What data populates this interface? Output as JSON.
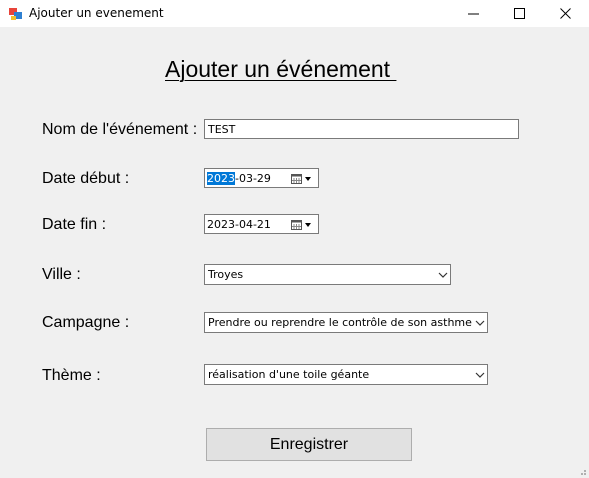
{
  "window": {
    "title": "Ajouter un evenement",
    "controls": {
      "minimize": "minimize-icon",
      "maximize": "maximize-icon",
      "close": "close-icon"
    }
  },
  "form": {
    "heading": "Ajouter un événement ",
    "fields": {
      "name": {
        "label": "Nom de l'événement :",
        "value": "TEST"
      },
      "start_date": {
        "label": "Date début :",
        "value_selected": "2023",
        "value_rest": "-03-29"
      },
      "end_date": {
        "label": "Date fin :",
        "value": "2023-04-21"
      },
      "city": {
        "label": "Ville :",
        "value": "Troyes"
      },
      "campaign": {
        "label": "Campagne :",
        "value": "Prendre ou reprendre le contrôle de son asthme"
      },
      "theme": {
        "label": "Thème :",
        "value": "réalisation d'une toile géante"
      }
    },
    "submit_label": "Enregistrer"
  },
  "colors": {
    "selection": "#0078d7",
    "background": "#f0f0f0",
    "button": "#e1e1e1"
  }
}
